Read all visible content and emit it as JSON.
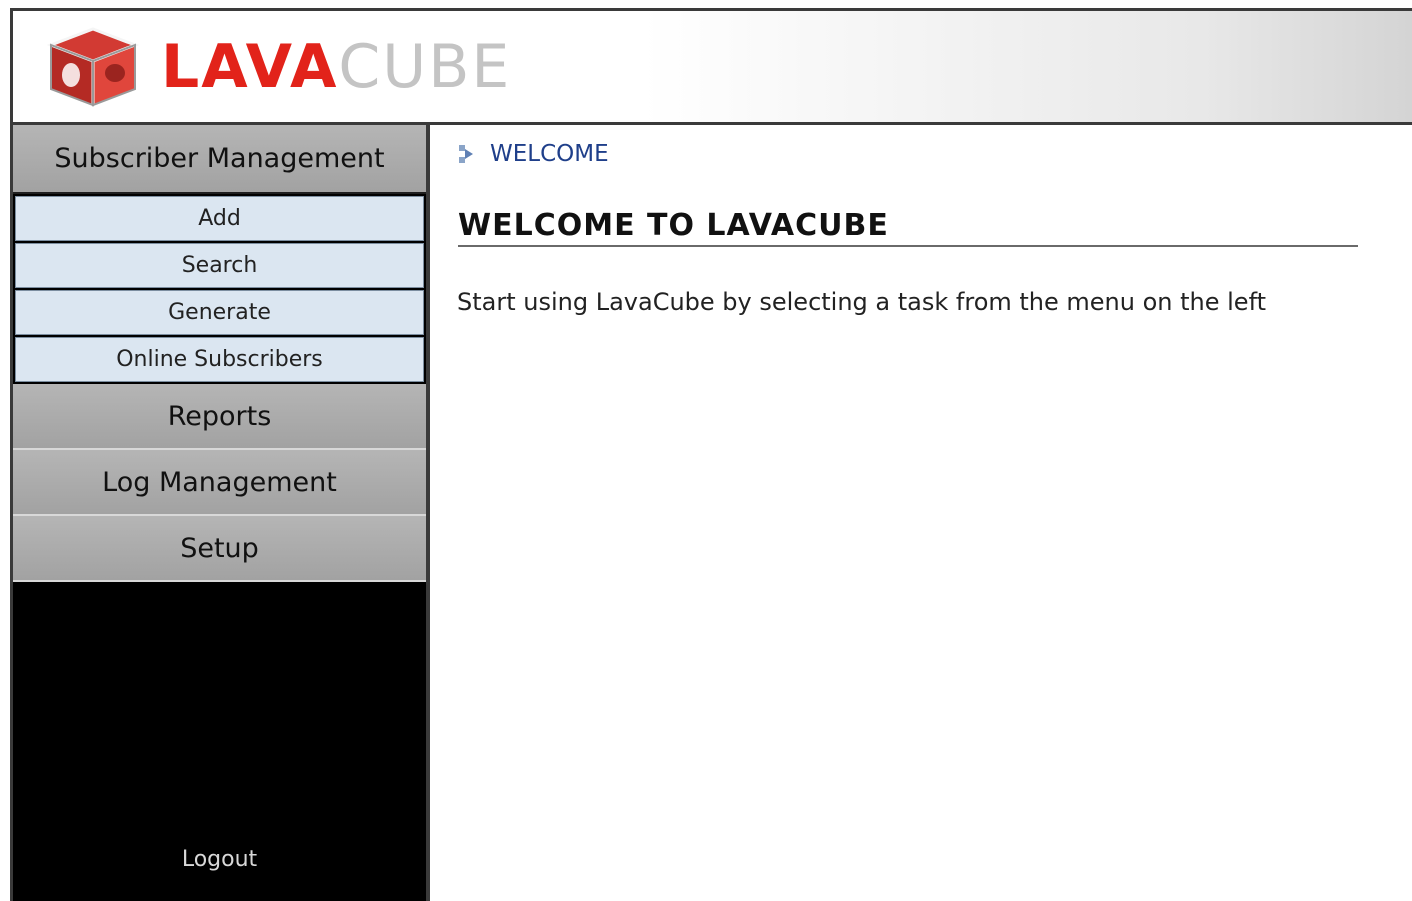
{
  "header": {
    "logo_text_lava": "LAVA",
    "logo_text_cube": "CUBE",
    "logo_icon": "cube-logo-icon"
  },
  "sidebar": {
    "sections": [
      {
        "label": "Subscriber Management",
        "items": [
          {
            "label": "Add"
          },
          {
            "label": "Search"
          },
          {
            "label": "Generate"
          },
          {
            "label": "Online Subscribers"
          }
        ]
      },
      {
        "label": "Reports"
      },
      {
        "label": "Log Management"
      },
      {
        "label": "Setup"
      }
    ],
    "logout_label": "Logout"
  },
  "main": {
    "breadcrumb": "WELCOME",
    "breadcrumb_icon": "arrow-bullet-icon",
    "title": "WELCOME TO LAVACUBE",
    "intro": "Start using LavaCube by selecting a task from the menu on the left"
  },
  "colors": {
    "brand_red": "#e2231a",
    "brand_grey": "#c4c4c4",
    "menu_section_bg": "#a8a8a8",
    "submenu_bg": "#dbe6f1",
    "breadcrumb_blue": "#1f3f8a"
  }
}
